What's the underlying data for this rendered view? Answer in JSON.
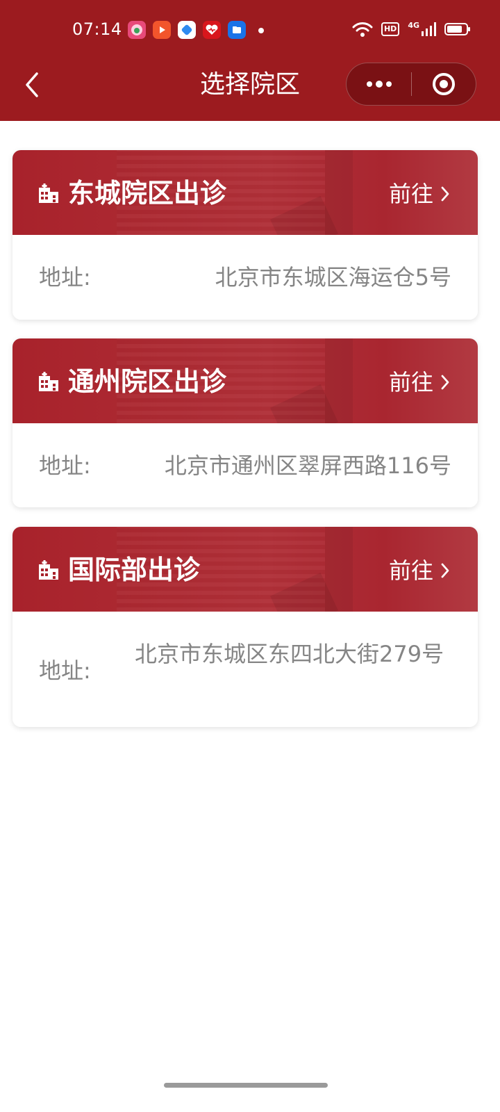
{
  "status_bar": {
    "time": "07:14",
    "app_icons": [
      "shopping-app-icon",
      "video-app-icon",
      "browser-app-icon",
      "health-app-icon",
      "files-app-icon"
    ],
    "hd_label": "HD",
    "network_label": "4G"
  },
  "nav": {
    "title": "选择院区"
  },
  "campuses": [
    {
      "name": "东城院区出诊",
      "go_label": "前往",
      "address_label": "地址:",
      "address": "北京市东城区海运仓5号"
    },
    {
      "name": "通州院区出诊",
      "go_label": "前往",
      "address_label": "地址:",
      "address": "北京市通州区翠屏西路116号"
    },
    {
      "name": "国际部出诊",
      "go_label": "前往",
      "address_label": "地址:",
      "address": "北京市东城区东四北大街279号"
    }
  ],
  "colors": {
    "nav_background": "#9c1b1f",
    "card_header": "#a8222b",
    "address_text": "#858585"
  }
}
